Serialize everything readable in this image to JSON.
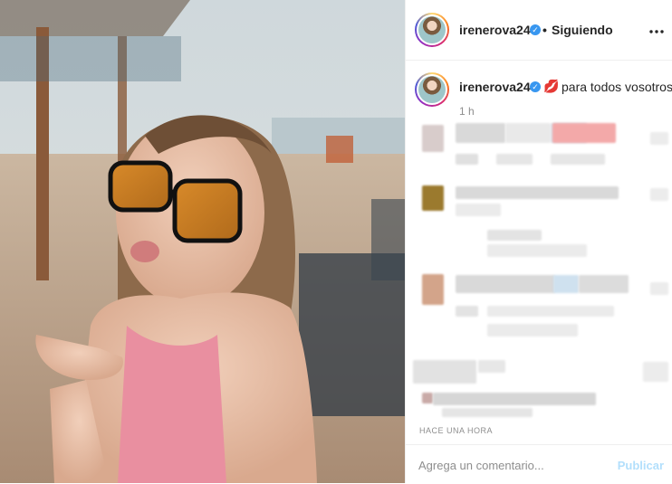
{
  "post": {
    "image_alt": "Foto de la publicación"
  },
  "header": {
    "username": "irenerova24",
    "separator": "•",
    "follow_label": "Siguiendo",
    "more_label": "•••"
  },
  "caption": {
    "username": "irenerova24",
    "emoji": "💋",
    "text": "para todos vosotros",
    "time": "1 h"
  },
  "comments": {
    "footer_time": "Hace una hora"
  },
  "comment_bar": {
    "placeholder": "Agrega un comentario...",
    "publish_label": "Publicar"
  },
  "colors": {
    "verified": "#3897f0",
    "publish_disabled": "#b2dffc",
    "secondary_text": "#8e8e8e"
  }
}
